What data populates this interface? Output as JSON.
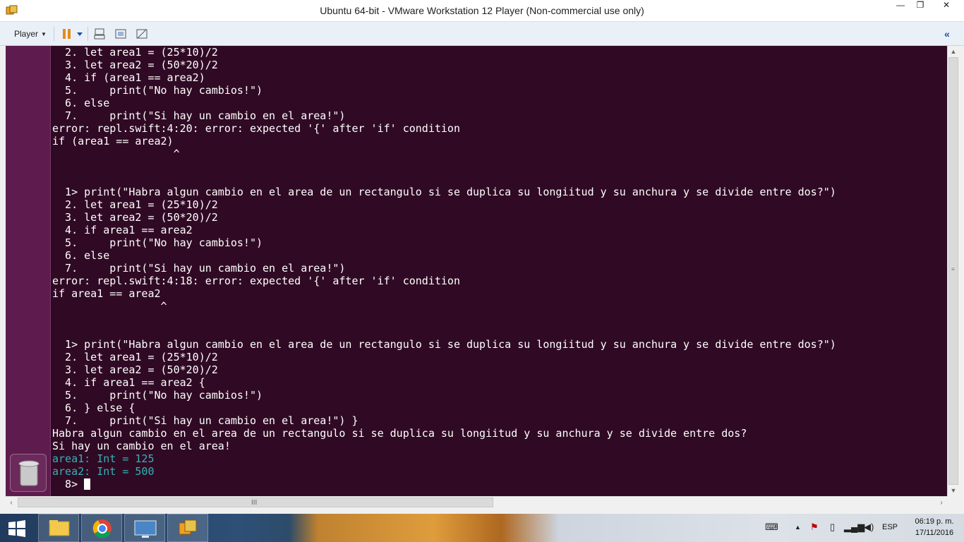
{
  "window": {
    "title": "Ubuntu 64-bit - VMware Workstation 12 Player (Non-commercial use only)",
    "minimize_glyph": "—",
    "maximize_glyph": "❐",
    "close_glyph": "✕"
  },
  "toolbar": {
    "player_menu_label": "Player",
    "icons": [
      "pause-icon",
      "send-ctrl-alt-del-icon",
      "fullscreen-icon",
      "unity-icon"
    ],
    "collapse_glyph": "«"
  },
  "terminal": {
    "lines": [
      "  2. let area1 = (25*10)/2",
      "  3. let area2 = (50*20)/2",
      "  4. if (area1 == area2)",
      "  5.     print(\"No hay cambios!\")",
      "  6. else",
      "  7.     print(\"Si hay un cambio en el area!\")",
      "error: repl.swift:4:20: error: expected '{' after 'if' condition",
      "if (area1 == area2)",
      "                   ^",
      "",
      "",
      "  1> print(\"Habra algun cambio en el area de un rectangulo si se duplica su longiitud y su anchura y se divide entre dos?\")",
      "  2. let area1 = (25*10)/2",
      "  3. let area2 = (50*20)/2",
      "  4. if area1 == area2",
      "  5.     print(\"No hay cambios!\")",
      "  6. else",
      "  7.     print(\"Si hay un cambio en el area!\")",
      "error: repl.swift:4:18: error: expected '{' after 'if' condition",
      "if area1 == area2",
      "                 ^",
      "",
      "",
      "  1> print(\"Habra algun cambio en el area de un rectangulo si se duplica su longiitud y su anchura y se divide entre dos?\")",
      "  2. let area1 = (25*10)/2",
      "  3. let area2 = (50*20)/2",
      "  4. if area1 == area2 {",
      "  5.     print(\"No hay cambios!\")",
      "  6. } else {",
      "  7.     print(\"Si hay un cambio en el area!\") }",
      "Habra algun cambio en el area de un rectangulo si se duplica su longiitud y su anchura y se divide entre dos?",
      "Si hay un cambio en el area!",
      "area1: Int = 125",
      "area2: Int = 500"
    ],
    "prompt": "  8> ",
    "colors": {
      "background": "#300a24",
      "text": "#ffffff",
      "result_text": "#34b1b6"
    }
  },
  "scrollbars": {
    "grip_glyph": "III"
  },
  "taskbar": {
    "apps": [
      "file-explorer-icon",
      "chrome-icon",
      "remote-desktop-icon",
      "vmware-player-icon"
    ],
    "language": "ESP",
    "time": "06:19 p. m.",
    "date": "17/11/2016"
  }
}
